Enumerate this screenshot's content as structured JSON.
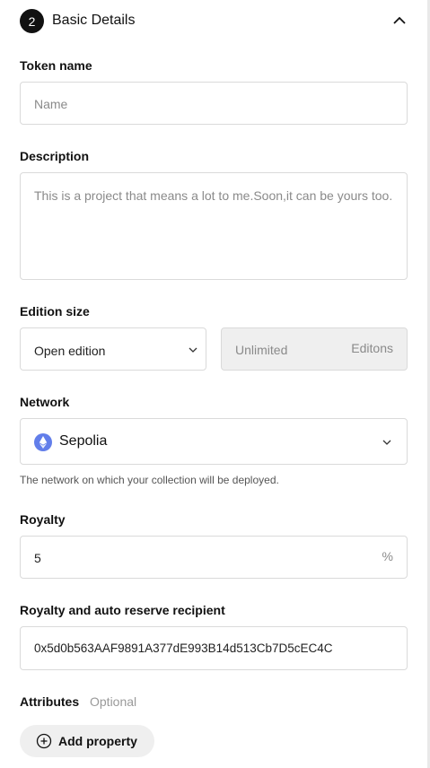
{
  "section": {
    "step_number": "2",
    "title": "Basic Details"
  },
  "token_name": {
    "label": "Token name",
    "placeholder": "Name"
  },
  "description": {
    "label": "Description",
    "placeholder": "This is a project that means a lot to me.Soon,it can be yours too."
  },
  "edition": {
    "label": "Edition size",
    "selected": "Open edition",
    "quantity_placeholder": "Unlimited",
    "suffix": "Editons"
  },
  "network": {
    "label": "Network",
    "selected": "Sepolia",
    "help": "The network on which your collection will be deployed.",
    "icon": "ethereum-icon",
    "icon_color": "#627eea"
  },
  "royalty": {
    "label": "Royalty",
    "value": "5",
    "suffix": "%"
  },
  "recipient": {
    "label": "Royalty and auto reserve recipient",
    "value": "0x5d0b563AAF9891A377dE993B14d513Cb7D5cEC4C"
  },
  "attributes": {
    "label": "Attributes",
    "optional": "Optional",
    "add_button": "Add property"
  }
}
